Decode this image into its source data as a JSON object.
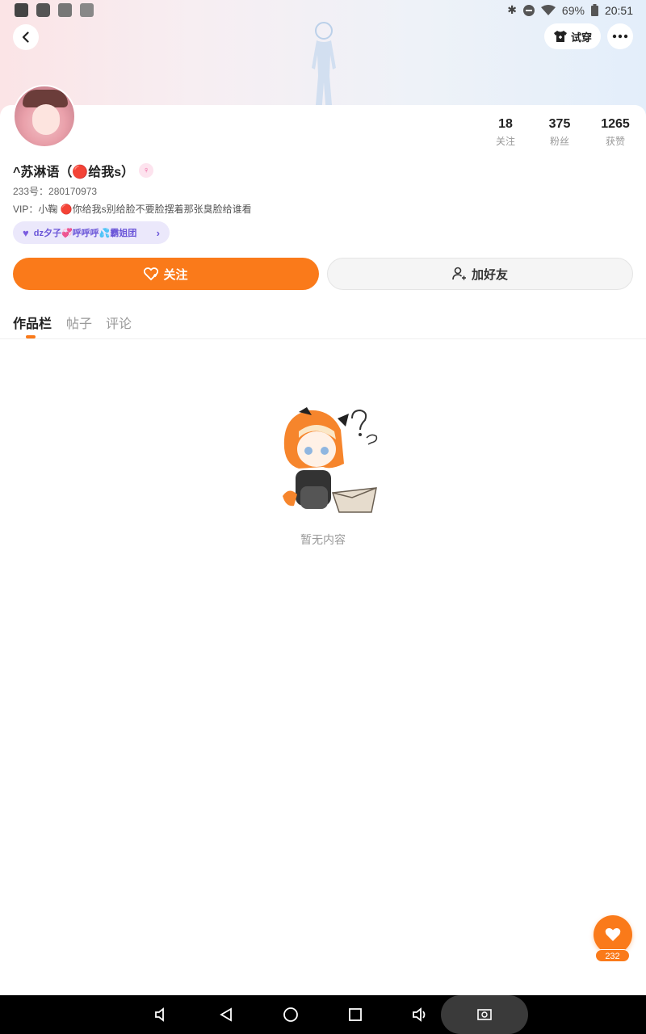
{
  "status_bar": {
    "battery": "69%",
    "time": "20:51",
    "icons": [
      "app-icon",
      "grid-icon",
      "image-icon",
      "keyboard-icon",
      "bluetooth-icon",
      "dnd-icon",
      "wifi-icon",
      "battery-icon"
    ]
  },
  "header": {
    "back_icon": "chevron-left-icon",
    "tryon_label": "试穿",
    "more_icon": "more-icon"
  },
  "profile": {
    "name": "^苏淋语（🔴给我s）",
    "gender_symbol": "♀",
    "uid": "233号：280170973",
    "vip": "VIP：小鞠 🔴你给我s别给脸不要脸摆着那张臭脸给谁看",
    "group_label": "dz夕子💞呼呼呼💦霸姐团",
    "stats": [
      {
        "value": "18",
        "label": "关注"
      },
      {
        "value": "375",
        "label": "粉丝"
      },
      {
        "value": "1265",
        "label": "获赞"
      }
    ]
  },
  "actions": {
    "follow_label": "关注",
    "add_friend_label": "加好友"
  },
  "tabs": [
    {
      "label": "作品栏",
      "active": true
    },
    {
      "label": "帖子",
      "active": false
    },
    {
      "label": "评论",
      "active": false
    }
  ],
  "empty_state": {
    "text": "暂无内容"
  },
  "like_fab": {
    "count": "232"
  },
  "colors": {
    "accent": "#fa7a1a",
    "group_pill_bg": "#ebe8fb",
    "group_pill_text": "#6a55d8"
  }
}
